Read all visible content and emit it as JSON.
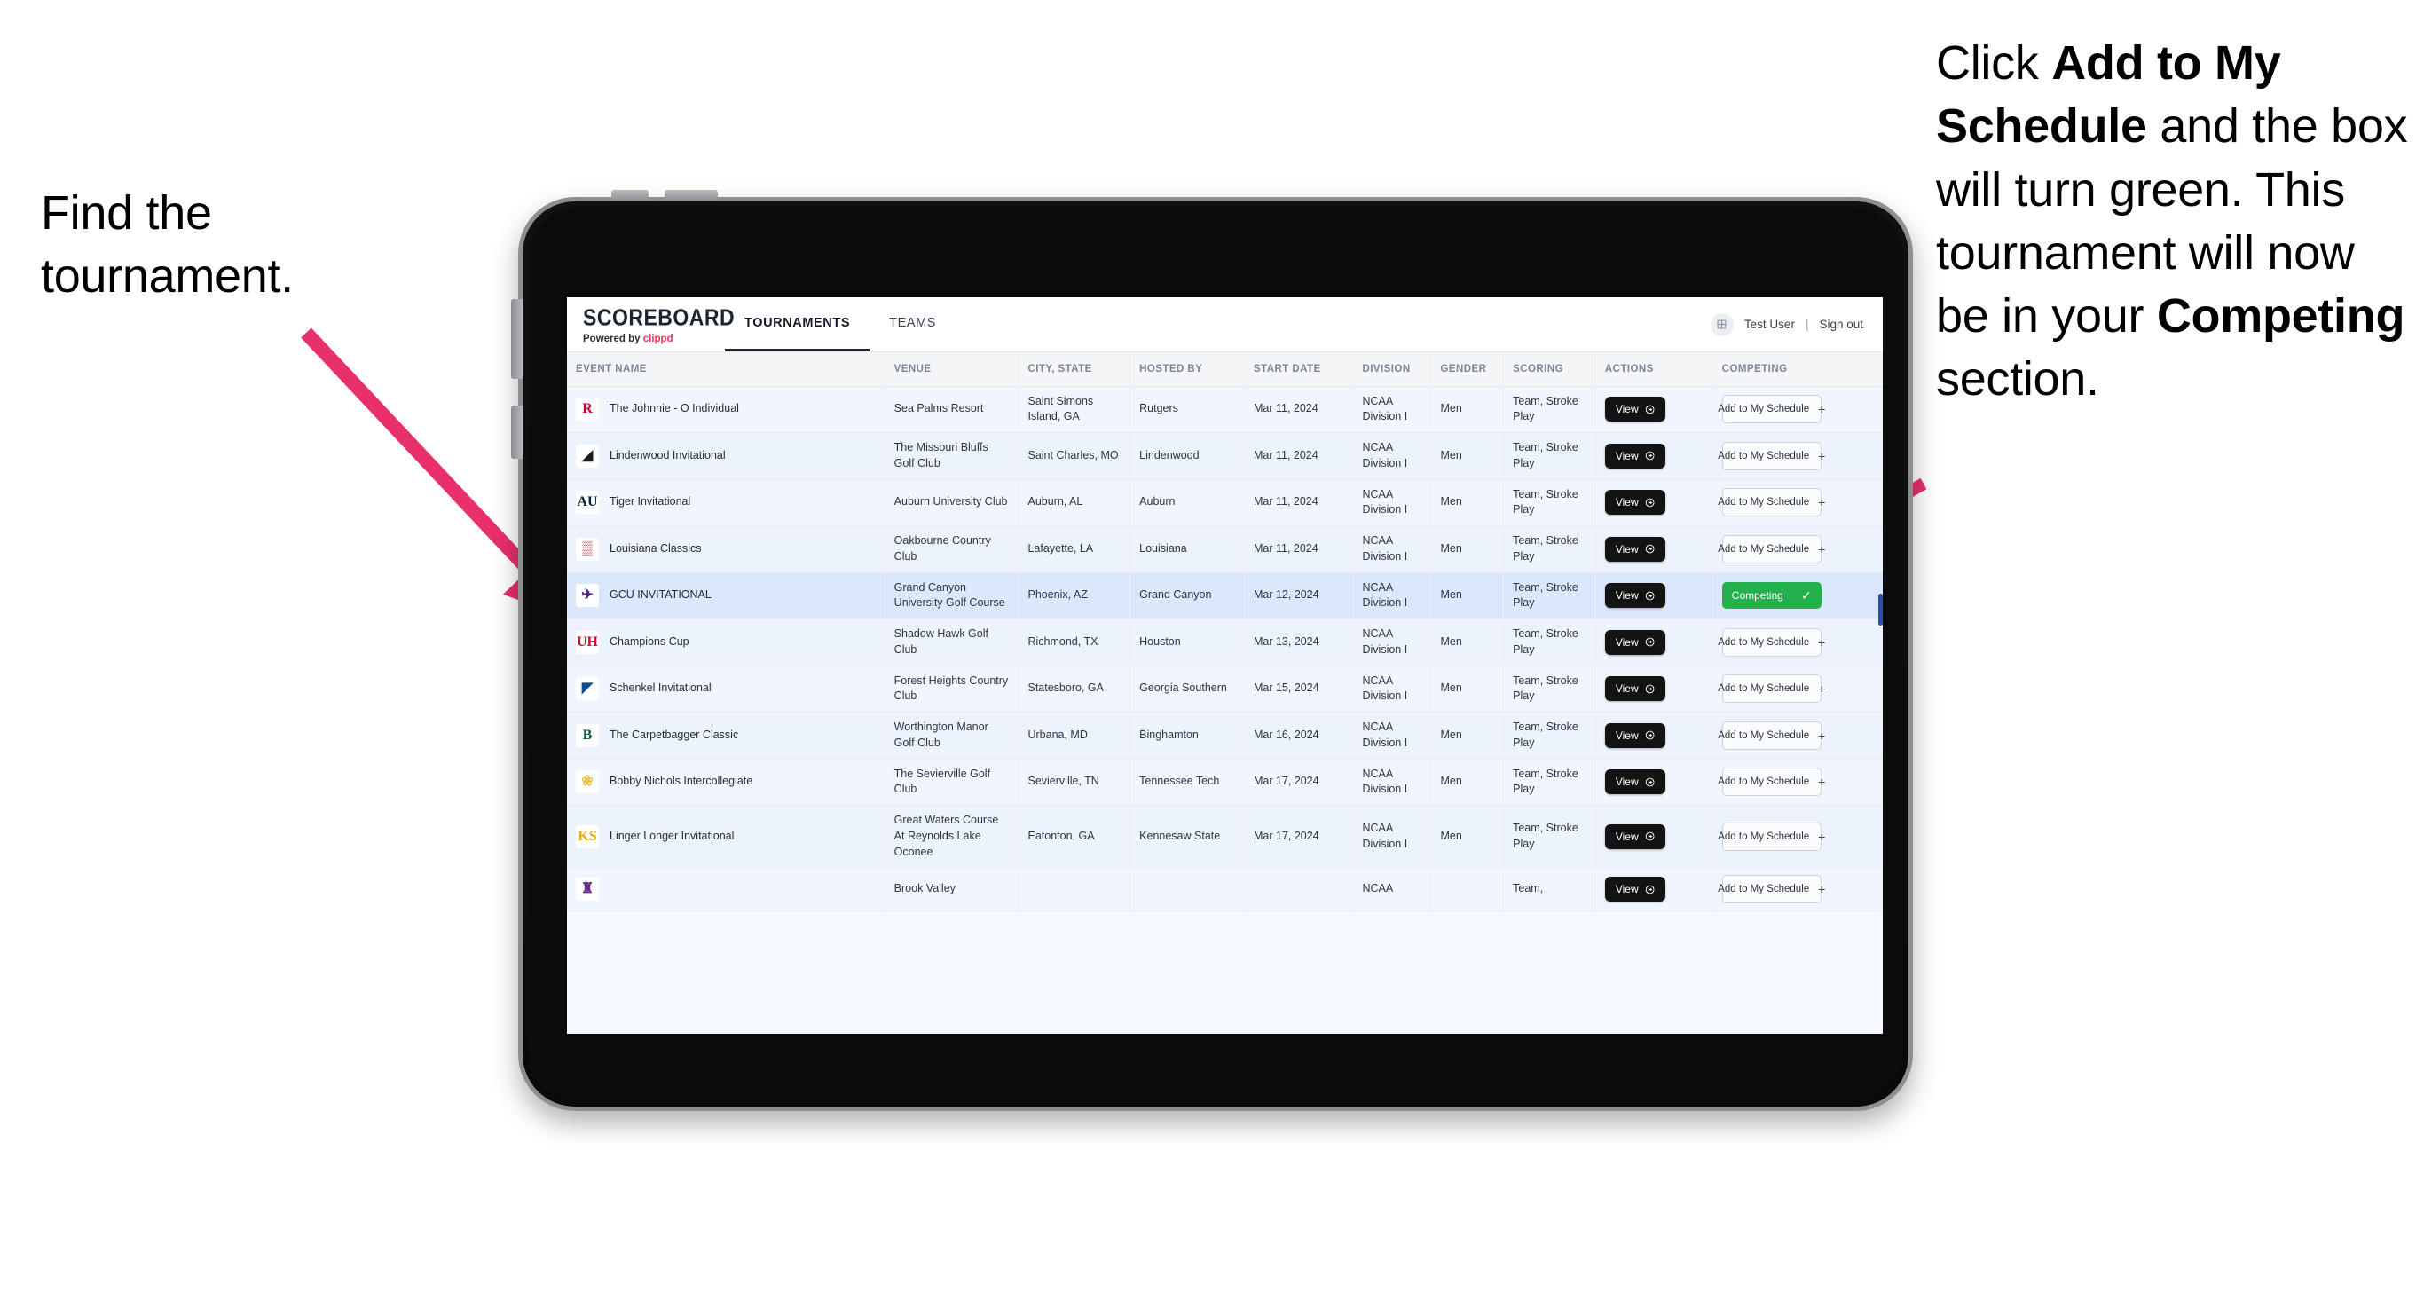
{
  "annotations": {
    "left": {
      "line1": "Find the",
      "line2": "tournament."
    },
    "right": {
      "part1": "Click ",
      "bold1": "Add to My Schedule",
      "part2": " and the box will turn green. This tournament will now be in your ",
      "bold2": "Competing",
      "part3": " section."
    },
    "arrow_color": "#e8306b"
  },
  "app": {
    "brand": {
      "title": "SCOREBOARD",
      "powered_prefix": "Powered by ",
      "powered_brand": "clippd"
    },
    "tabs": [
      {
        "label": "TOURNAMENTS",
        "active": true
      },
      {
        "label": "TEAMS",
        "active": false
      }
    ],
    "user": {
      "avatar_icon": "user-avatar-icon",
      "name": "Test User",
      "separator": "|",
      "signout": "Sign out"
    }
  },
  "table": {
    "columns": [
      "EVENT NAME",
      "VENUE",
      "CITY, STATE",
      "HOSTED BY",
      "START DATE",
      "DIVISION",
      "GENDER",
      "SCORING",
      "ACTIONS",
      "COMPETING"
    ],
    "action_label": "View",
    "add_label": "Add to My Schedule",
    "add_plus": "+",
    "competing_label": "Competing",
    "competing_check": "✓",
    "competing_color": "#22b14c",
    "rows": [
      {
        "logo_text": "R",
        "logo_fg": "#cc0033",
        "logo_bg": "#ffffff",
        "event": "The Johnnie - O Individual",
        "venue": "Sea Palms Resort",
        "city": "Saint Simons Island, GA",
        "host": "Rutgers",
        "date": "Mar 11, 2024",
        "division": "NCAA Division I",
        "gender": "Men",
        "scoring": "Team, Stroke Play",
        "competing": false
      },
      {
        "logo_text": "◢",
        "logo_fg": "#1b1b1b",
        "logo_bg": "#ffffff",
        "event": "Lindenwood Invitational",
        "venue": "The Missouri Bluffs Golf Club",
        "city": "Saint Charles, MO",
        "host": "Lindenwood",
        "date": "Mar 11, 2024",
        "division": "NCAA Division I",
        "gender": "Men",
        "scoring": "Team, Stroke Play",
        "competing": false
      },
      {
        "logo_text": "AU",
        "logo_fg": "#0c2340",
        "logo_bg": "#ffffff",
        "event": "Tiger Invitational",
        "venue": "Auburn University Club",
        "city": "Auburn, AL",
        "host": "Auburn",
        "date": "Mar 11, 2024",
        "division": "NCAA Division I",
        "gender": "Men",
        "scoring": "Team, Stroke Play",
        "competing": false
      },
      {
        "logo_text": "▒",
        "logo_fg": "#9e1b32",
        "logo_bg": "#ffffff",
        "event": "Louisiana Classics",
        "venue": "Oakbourne Country Club",
        "city": "Lafayette, LA",
        "host": "Louisiana",
        "date": "Mar 11, 2024",
        "division": "NCAA Division I",
        "gender": "Men",
        "scoring": "Team, Stroke Play",
        "competing": false
      },
      {
        "logo_text": "✈",
        "logo_fg": "#522398",
        "logo_bg": "#ffffff",
        "event": "GCU INVITATIONAL",
        "venue": "Grand Canyon University Golf Course",
        "city": "Phoenix, AZ",
        "host": "Grand Canyon",
        "date": "Mar 12, 2024",
        "division": "NCAA Division I",
        "gender": "Men",
        "scoring": "Team, Stroke Play",
        "competing": true
      },
      {
        "logo_text": "UH",
        "logo_fg": "#c8102e",
        "logo_bg": "#ffffff",
        "event": "Champions Cup",
        "venue": "Shadow Hawk Golf Club",
        "city": "Richmond, TX",
        "host": "Houston",
        "date": "Mar 13, 2024",
        "division": "NCAA Division I",
        "gender": "Men",
        "scoring": "Team, Stroke Play",
        "competing": false
      },
      {
        "logo_text": "◤",
        "logo_fg": "#0f4d92",
        "logo_bg": "#ffffff",
        "event": "Schenkel Invitational",
        "venue": "Forest Heights Country Club",
        "city": "Statesboro, GA",
        "host": "Georgia Southern",
        "date": "Mar 15, 2024",
        "division": "NCAA Division I",
        "gender": "Men",
        "scoring": "Team, Stroke Play",
        "competing": false
      },
      {
        "logo_text": "B",
        "logo_fg": "#0d5c3c",
        "logo_bg": "#ffffff",
        "event": "The Carpetbagger Classic",
        "venue": "Worthington Manor Golf Club",
        "city": "Urbana, MD",
        "host": "Binghamton",
        "date": "Mar 16, 2024",
        "division": "NCAA Division I",
        "gender": "Men",
        "scoring": "Team, Stroke Play",
        "competing": false
      },
      {
        "logo_text": "❀",
        "logo_fg": "#e8c33c",
        "logo_bg": "#ffffff",
        "event": "Bobby Nichols Intercollegiate",
        "venue": "The Sevierville Golf Club",
        "city": "Sevierville, TN",
        "host": "Tennessee Tech",
        "date": "Mar 17, 2024",
        "division": "NCAA Division I",
        "gender": "Men",
        "scoring": "Team, Stroke Play",
        "competing": false
      },
      {
        "logo_text": "KS",
        "logo_fg": "#edaa00",
        "logo_bg": "#ffffff",
        "event": "Linger Longer Invitational",
        "venue": "Great Waters Course At Reynolds Lake Oconee",
        "city": "Eatonton, GA",
        "host": "Kennesaw State",
        "date": "Mar 17, 2024",
        "division": "NCAA Division I",
        "gender": "Men",
        "scoring": "Team, Stroke Play",
        "competing": false
      },
      {
        "logo_text": "♜",
        "logo_fg": "#6b2d8b",
        "logo_bg": "#ffffff",
        "event": "",
        "venue": "Brook Valley",
        "city": "",
        "host": "",
        "date": "",
        "division": "NCAA",
        "gender": "",
        "scoring": "Team,",
        "competing": false
      }
    ]
  }
}
